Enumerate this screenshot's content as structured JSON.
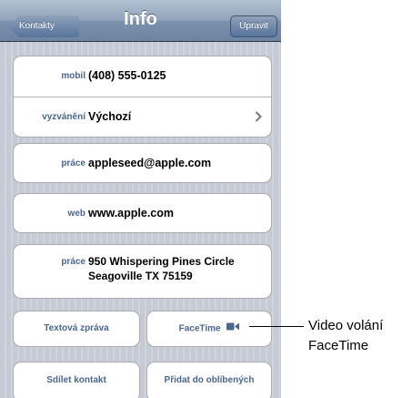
{
  "navbar": {
    "back_label": "Kontakty",
    "title": "Info",
    "edit_label": "Upravit"
  },
  "contact_card": {
    "phone": {
      "label": "mobil",
      "value": "(408) 555-0125"
    },
    "ringtone": {
      "label": "vyzvánění",
      "value": "Výchozí"
    }
  },
  "email": {
    "label": "práce",
    "value": "appleseed@apple.com"
  },
  "website": {
    "label": "web",
    "value": "www.apple.com"
  },
  "address": {
    "label": "práce",
    "line1": "950 Whispering Pines Circle",
    "line2": "Seagoville TX 75159"
  },
  "actions": {
    "text_message": "Textová zpráva",
    "facetime": "FaceTime",
    "share_contact": "Sdílet kontakt",
    "add_favorite": "Přidat do oblíbených"
  },
  "callout": {
    "line1": "Video volání",
    "line2": "FaceTime"
  },
  "icons": {
    "chevron": "chevron-right-icon",
    "facetime": "video-camera-icon"
  },
  "colors": {
    "label_blue": "#4c6690",
    "navbar": "#7c91ad",
    "background": "#c7ccd5"
  }
}
